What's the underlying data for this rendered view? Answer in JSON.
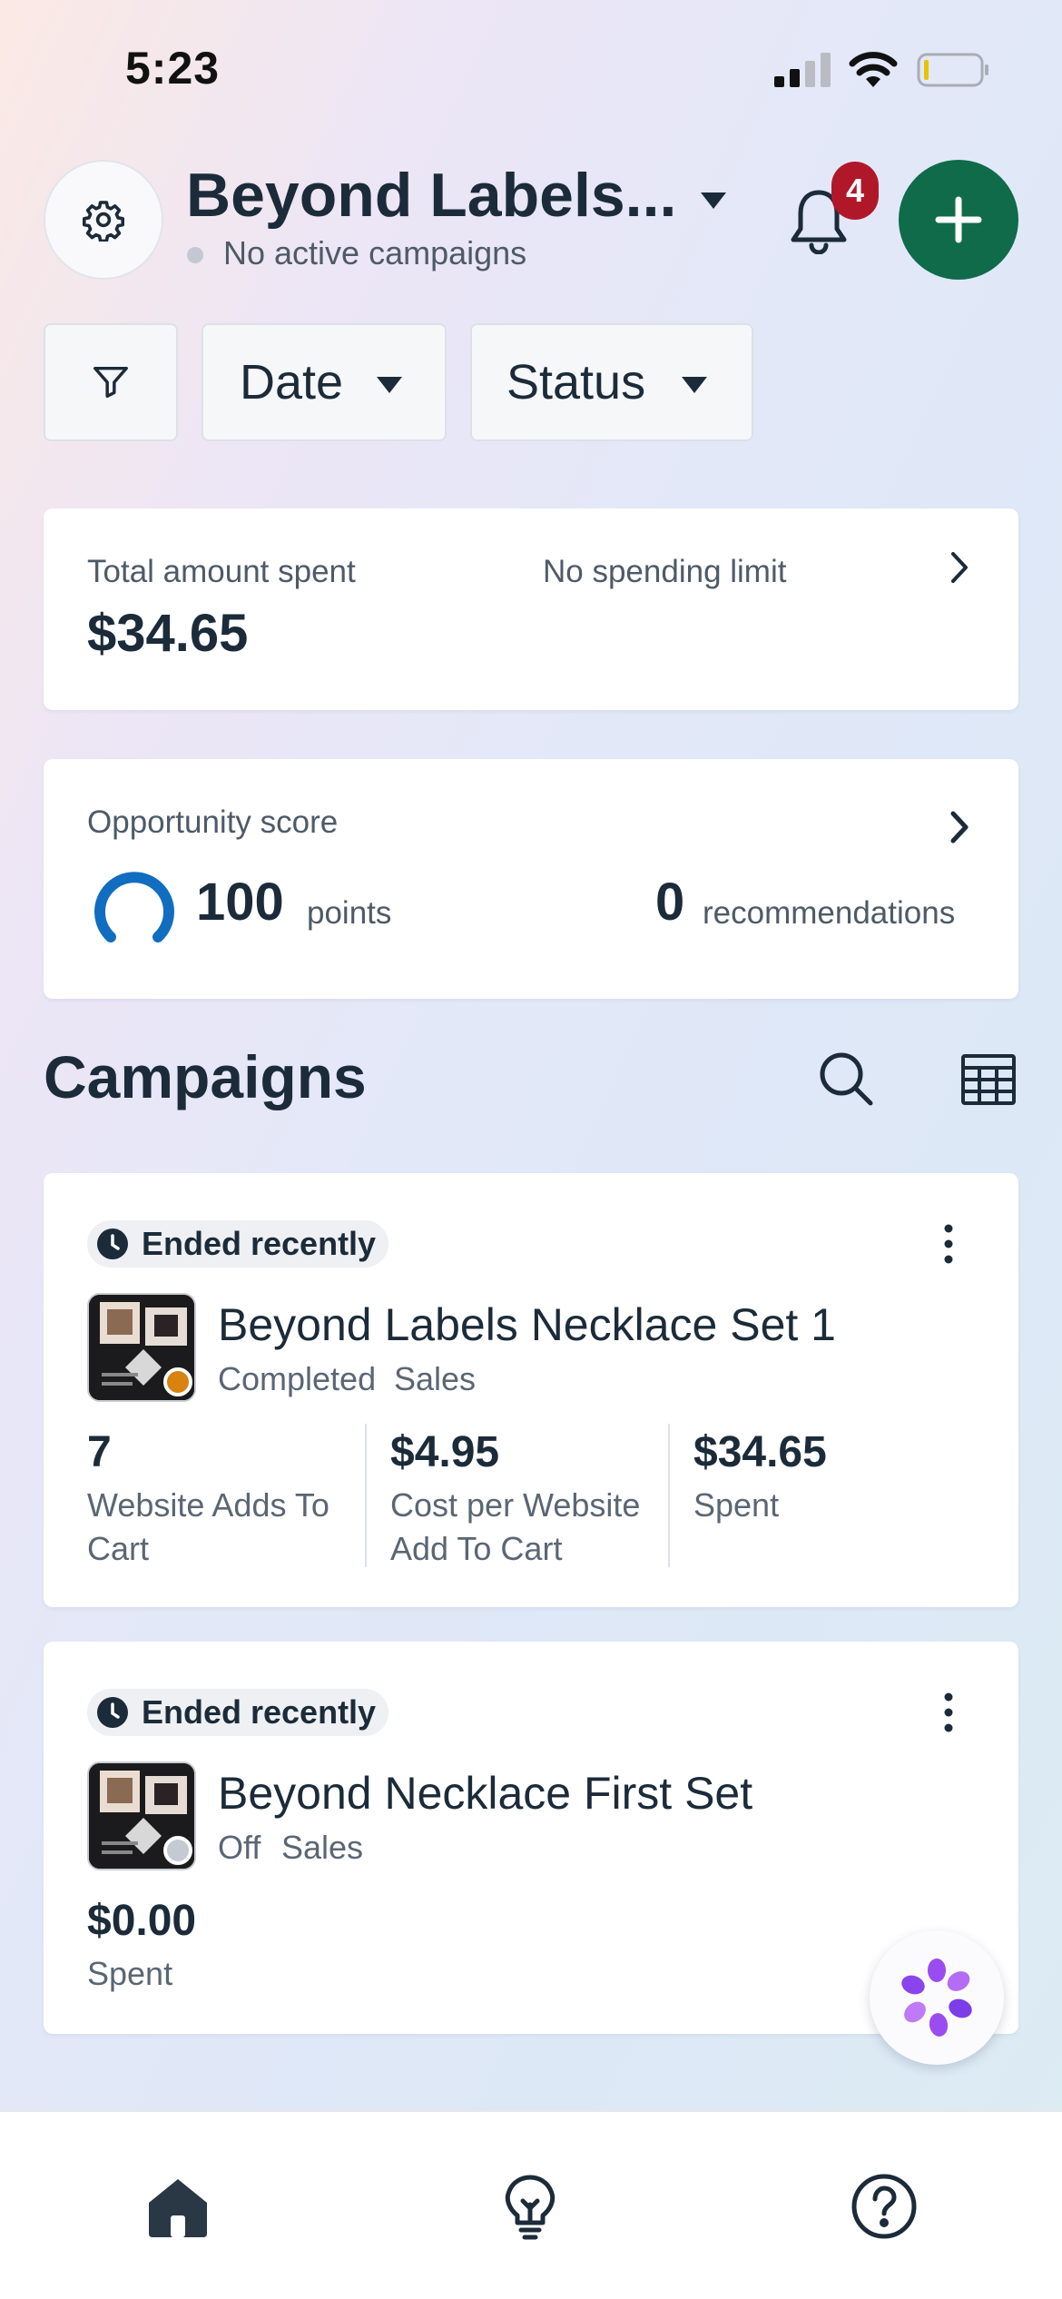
{
  "status_bar": {
    "time": "5:23"
  },
  "header": {
    "title": "Beyond Labels...",
    "subtitle": "No active campaigns",
    "notification_count": "4"
  },
  "filters": {
    "date_label": "Date",
    "status_label": "Status"
  },
  "spend_card": {
    "label": "Total amount spent",
    "value": "$34.65",
    "limit_label": "No spending limit"
  },
  "opportunity_card": {
    "label": "Opportunity score",
    "score": "100",
    "score_unit": "points",
    "recommendations_count": "0",
    "recommendations_label": "recommendations"
  },
  "campaigns": {
    "heading": "Campaigns",
    "items": [
      {
        "status": "Ended recently",
        "name": "Beyond Labels Necklace Set 1",
        "state": "Completed",
        "objective": "Sales",
        "dot_color": "#d8820f",
        "metrics": [
          {
            "value": "7",
            "label": "Website Adds To Cart"
          },
          {
            "value": "$4.95",
            "label": "Cost per Website Add To Cart"
          },
          {
            "value": "$34.65",
            "label": "Spent"
          }
        ]
      },
      {
        "status": "Ended recently",
        "name": "Beyond Necklace First Set",
        "state": "Off",
        "objective": "Sales",
        "dot_color": "#c5cad2",
        "metrics": [
          {
            "value": "$0.00",
            "label": "Spent"
          }
        ]
      }
    ]
  },
  "bottom_nav": [
    "home-icon",
    "lightbulb-icon",
    "help-icon"
  ],
  "colors": {
    "accent_green": "#0f6b4a",
    "badge_red": "#b0182a",
    "score_ring": "#116dbf"
  }
}
